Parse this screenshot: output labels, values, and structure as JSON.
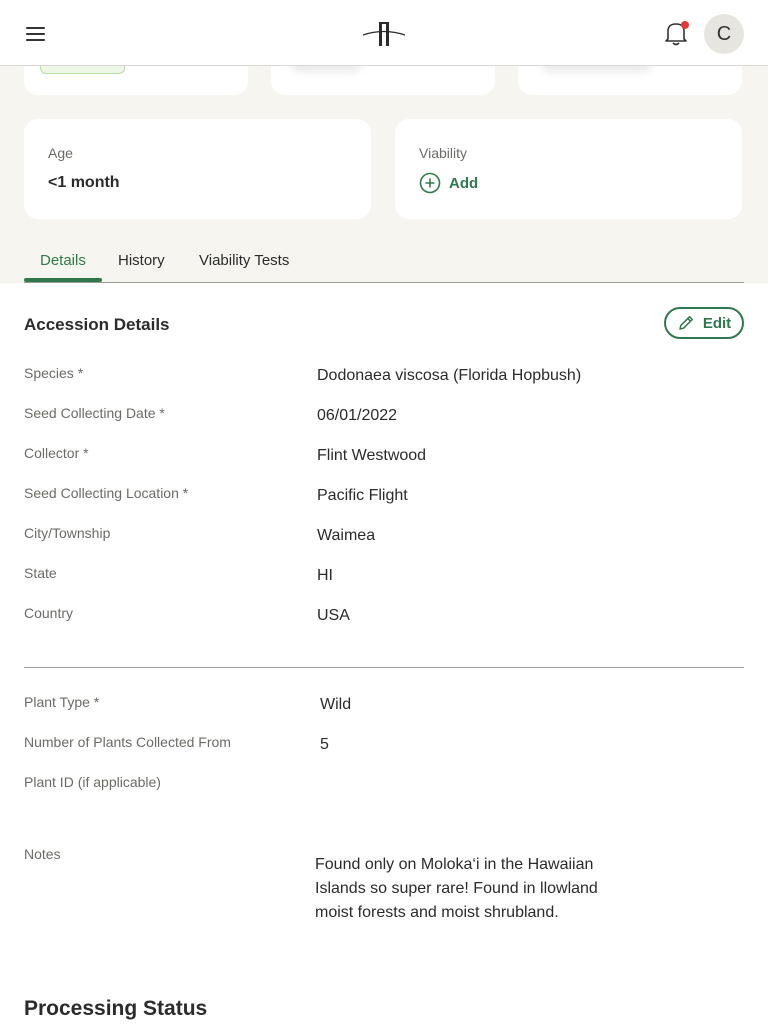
{
  "header": {
    "avatar_initial": "C"
  },
  "stats": {
    "age_label": "Age",
    "age_value": "<1 month",
    "viability_label": "Viability",
    "viability_add": "Add"
  },
  "tabs": [
    {
      "label": "Details",
      "active": true
    },
    {
      "label": "History"
    },
    {
      "label": "Viability Tests"
    }
  ],
  "accession": {
    "title": "Accession Details",
    "edit_label": "Edit",
    "fields": [
      {
        "label": "Species *",
        "value": "Dodonaea viscosa (Florida Hopbush)"
      },
      {
        "label": "Seed Collecting Date *",
        "value": "06/01/2022"
      },
      {
        "label": "Collector *",
        "value": "Flint Westwood"
      },
      {
        "label": "Seed Collecting Location *",
        "value": "Pacific Flight"
      },
      {
        "label": "City/Township",
        "value": "Waimea"
      },
      {
        "label": "State",
        "value": "HI"
      },
      {
        "label": "Country",
        "value": "USA"
      }
    ],
    "plant_fields": [
      {
        "label": "Plant Type *",
        "value": "Wild"
      },
      {
        "label": "Number of Plants Collected From",
        "value": "5"
      },
      {
        "label": "Plant ID (if applicable)",
        "value": ""
      }
    ],
    "notes_label": "Notes",
    "notes_value": "Found only on Moloka‘i in the Hawaiian Islands so super rare! Found in llowland moist forests and moist shrubland."
  },
  "processing": {
    "title": "Processing Status"
  },
  "colors": {
    "brand_green": "#2f7a4d",
    "background": "#f6f5f0",
    "notification_dot": "#e53935"
  },
  "icons": [
    "menu-icon",
    "logo-icon",
    "bell-icon",
    "plus-circle-icon",
    "pencil-icon"
  ]
}
